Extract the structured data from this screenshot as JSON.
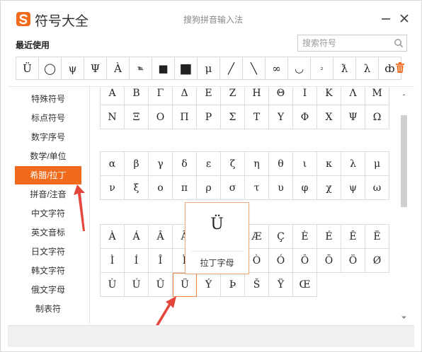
{
  "window": {
    "title": "符号大全",
    "subtitle": "搜狗拼音输入法",
    "accent_color": "#f26b1d",
    "logo_icon": "sogou-s-icon",
    "minimize_icon": "minimize-icon",
    "close_icon": "close-icon"
  },
  "recent": {
    "label": "最近使用",
    "symbols": [
      "Ü",
      "◯",
      "ψ",
      "Ψ",
      "À",
      "℡",
      "■",
      "■",
      "μ",
      "╱",
      "╲",
      "∞",
      "◡",
      "₂",
      "ƛ",
      "λ",
      "ȸ"
    ],
    "delete_icon": "trash-icon"
  },
  "search": {
    "placeholder": "搜索符号",
    "value": "",
    "icon": "search-icon"
  },
  "sidebar": {
    "items": [
      {
        "label": "特殊符号"
      },
      {
        "label": "标点符号"
      },
      {
        "label": "数字序号"
      },
      {
        "label": "数学/单位"
      },
      {
        "label": "希腊/拉丁",
        "active": true
      },
      {
        "label": "拼音/注音"
      },
      {
        "label": "中文字符"
      },
      {
        "label": "英文音标"
      },
      {
        "label": "日文字符"
      },
      {
        "label": "韩文字符"
      },
      {
        "label": "俄文字母"
      },
      {
        "label": "制表符"
      }
    ]
  },
  "greek_upper": [
    [
      "Α",
      "Β",
      "Γ",
      "Δ",
      "Ε",
      "Ζ",
      "Η",
      "Θ",
      "Ι",
      "Κ",
      "Λ",
      "Μ"
    ],
    [
      "Ν",
      "Ξ",
      "Ο",
      "Π",
      "Ρ",
      "Σ",
      "Τ",
      "Υ",
      "Φ",
      "Χ",
      "Ψ",
      "Ω"
    ]
  ],
  "greek_lower": [
    [
      "α",
      "β",
      "γ",
      "δ",
      "ε",
      "ζ",
      "η",
      "θ",
      "ι",
      "κ",
      "λ",
      "μ"
    ],
    [
      "ν",
      "ξ",
      "ο",
      "π",
      "ρ",
      "σ",
      "τ",
      "υ",
      "φ",
      "χ",
      "ψ",
      "ω"
    ]
  ],
  "latin": [
    [
      "À",
      "Á",
      "Â",
      "Ã",
      "",
      "",
      "Æ",
      "Ç",
      "È",
      "É",
      "Ê",
      "Ë"
    ],
    [
      "Ì",
      "Í",
      "Î",
      "Ï",
      "",
      "",
      "Ò",
      "Ó",
      "Ô",
      "Õ",
      "Ö",
      "Ø"
    ],
    [
      "Ù",
      "Ú",
      "Û",
      "Ü",
      "Ý",
      "Þ",
      "Š",
      "Ÿ",
      "Œ"
    ]
  ],
  "popup": {
    "symbol": "Ü",
    "label": "拉丁字母"
  }
}
